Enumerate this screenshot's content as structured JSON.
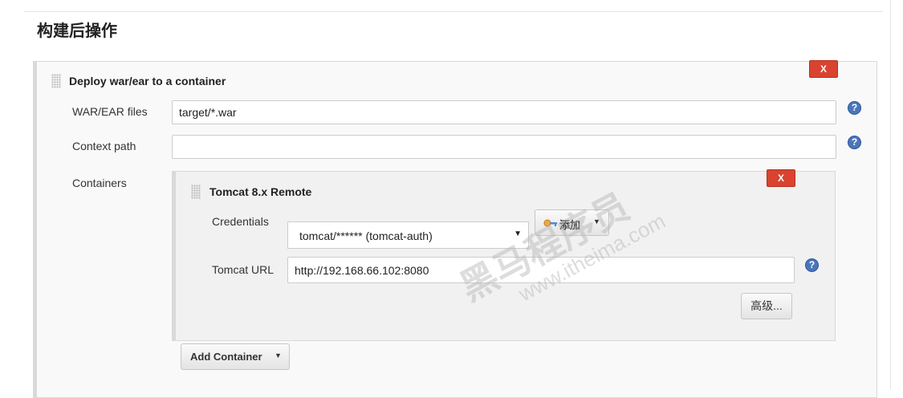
{
  "section": {
    "title": "构建后操作"
  },
  "deploy_block": {
    "title": "Deploy war/ear to a container",
    "delete_label": "X",
    "war_ear_files": {
      "label": "WAR/EAR files",
      "value": "target/*.war"
    },
    "context_path": {
      "label": "Context path",
      "value": ""
    },
    "containers_label": "Containers",
    "help_label": "?"
  },
  "container": {
    "title": "Tomcat 8.x Remote",
    "delete_label": "X",
    "credentials": {
      "label": "Credentials",
      "selected": "tomcat/****** (tomcat-auth)",
      "arrow": "▼"
    },
    "add_button": {
      "label": "添加",
      "caret": "▼"
    },
    "tomcat_url": {
      "label": "Tomcat URL",
      "value": "http://192.168.66.102:8080"
    },
    "advanced_button": "高级...",
    "help_label": "?"
  },
  "add_container": {
    "label": "Add Container",
    "caret": "▼"
  },
  "watermark": {
    "main": "黑马程序员",
    "sub": "www.itheima.com"
  }
}
